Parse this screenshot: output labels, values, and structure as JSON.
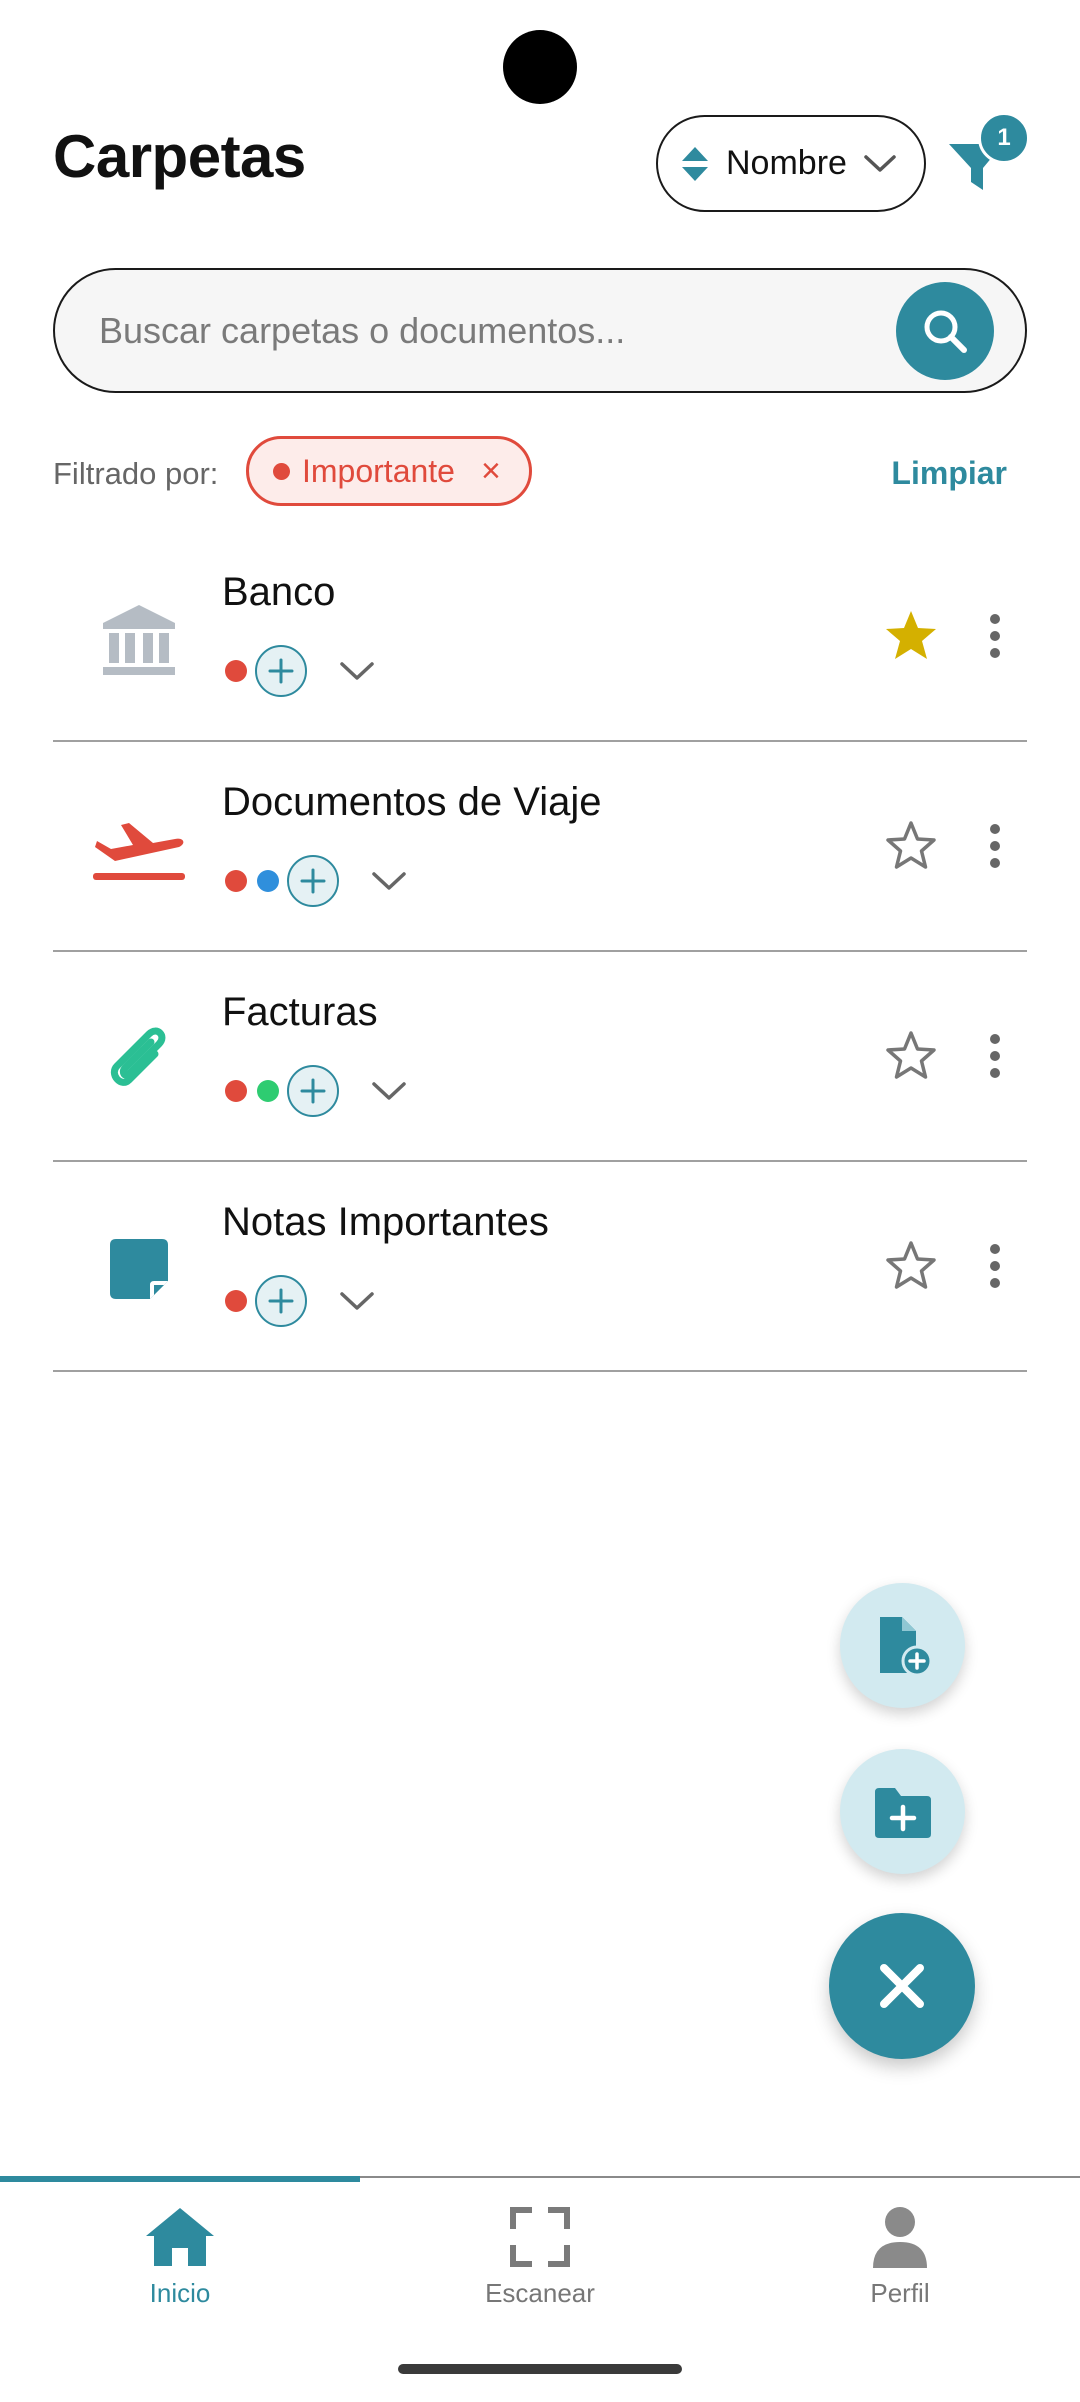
{
  "header": {
    "title": "Carpetas",
    "sort_label": "Nombre",
    "filter_count": "1"
  },
  "search": {
    "placeholder": "Buscar carpetas o documentos...",
    "value": ""
  },
  "filters": {
    "label": "Filtrado por:",
    "chip_label": "Importante",
    "chip_remove": "×",
    "clear_label": "Limpiar"
  },
  "colors": {
    "accent": "#2e8a9e",
    "important_red": "#e04a3c",
    "tag_blue": "#2f8fdc",
    "tag_green": "#2ecc71",
    "star_gold": "#d4b000"
  },
  "folders": [
    {
      "name": "Banco",
      "icon": "bank-icon",
      "tags": [
        "#e04a3c"
      ],
      "favorite": true
    },
    {
      "name": "Documentos de Viaje",
      "icon": "airplane-icon",
      "tags": [
        "#e04a3c",
        "#2f8fdc"
      ],
      "favorite": false
    },
    {
      "name": "Facturas",
      "icon": "paperclip-icon",
      "tags": [
        "#e04a3c",
        "#2ecc71"
      ],
      "favorite": false
    },
    {
      "name": "Notas Importantes",
      "icon": "sticky-note-icon",
      "tags": [
        "#e04a3c"
      ],
      "favorite": false
    }
  ],
  "fab": {
    "new_document_icon": "file-add-icon",
    "new_folder_icon": "folder-add-icon",
    "close_icon": "close-icon"
  },
  "nav": [
    {
      "label": "Inicio",
      "icon": "home-icon",
      "active": true
    },
    {
      "label": "Escanear",
      "icon": "scan-icon",
      "active": false
    },
    {
      "label": "Perfil",
      "icon": "user-icon",
      "active": false
    }
  ]
}
